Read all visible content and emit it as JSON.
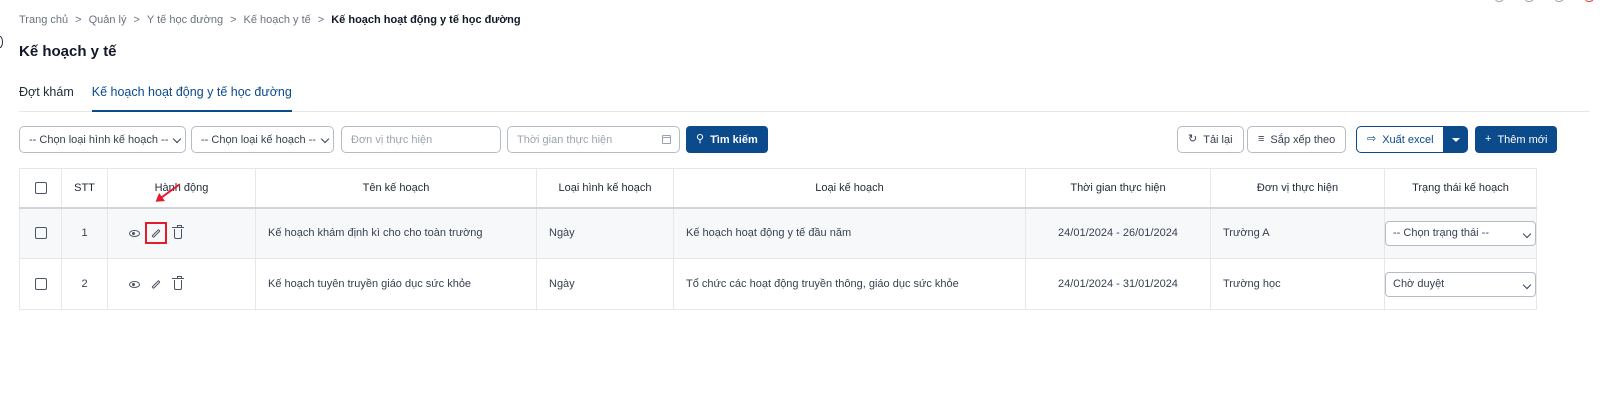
{
  "breadcrumb": [
    "Trang chủ",
    "Quản lý",
    "Y tế học đường",
    "Kế hoạch y tế",
    "Kế hoạch hoạt động y tế học đường"
  ],
  "page_title": "Kế hoạch y tế",
  "tabs": [
    {
      "label": "Đợt khám",
      "active": false
    },
    {
      "label": "Kế hoạch hoạt động y tế học đường",
      "active": true
    }
  ],
  "filters": {
    "plan_type_select": "-- Chọn loại hình kế hoạch --",
    "plan_category_select": "-- Chọn loại kế hoạch --",
    "unit_placeholder": "Đơn vị thực hiện",
    "time_placeholder": "Thời gian thực hiện",
    "search_label": "Tìm kiếm"
  },
  "actions": {
    "reload_label": "Tải lại",
    "sort_label": "Sắp xếp theo",
    "export_label": "Xuất excel",
    "add_label": "Thêm mới"
  },
  "table": {
    "headers": [
      "STT",
      "Hành động",
      "Tên kế hoạch",
      "Loại hình kế hoạch",
      "Loại kế hoạch",
      "Thời gian thực hiện",
      "Đơn vị thực hiện",
      "Trạng thái kế hoạch"
    ],
    "rows": [
      {
        "stt": "1",
        "name": "Kế hoạch khám định kì cho cho toàn trường",
        "plan_type": "Ngày",
        "plan_category": "Kế hoạch hoạt động y tế đầu năm",
        "time": "24/01/2024 - 26/01/2024",
        "unit": "Trường A",
        "status": "-- Chọn trạng thái --"
      },
      {
        "stt": "2",
        "name": "Kế hoạch tuyên truyền giáo dục sức khỏe",
        "plan_type": "Ngày",
        "plan_category": "Tổ chức các hoạt động truyền thông, giáo dục sức khỏe",
        "time": "24/01/2024 - 31/01/2024",
        "unit": "Trường học",
        "status": "Chờ duyệt"
      }
    ]
  },
  "colors": {
    "primary": "#0b4a8b",
    "highlight": "#e11d2e"
  },
  "icons": [
    "search-icon",
    "reload-icon",
    "sort-icon",
    "export-icon",
    "plus-icon",
    "eye-icon",
    "pencil-icon",
    "trash-icon",
    "calendar-icon"
  ]
}
